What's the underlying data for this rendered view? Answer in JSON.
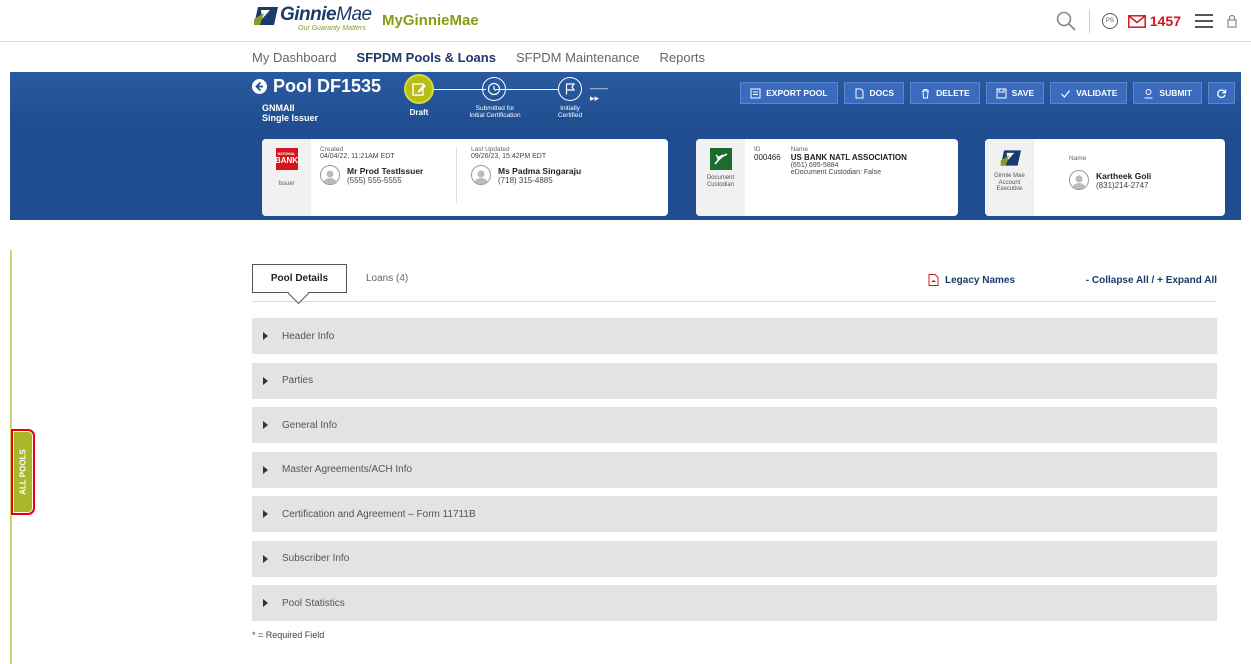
{
  "header": {
    "logo_name_bold": "Ginnie",
    "logo_name_light": "Mae",
    "logo_tagline": "Our Guaranty Matters",
    "app_name": "MyGinnieMae",
    "avatar_initials": "PS",
    "mail_count": "1457"
  },
  "nav": {
    "items": [
      {
        "label": "My Dashboard",
        "active": false
      },
      {
        "label": "SFPDM Pools & Loans",
        "active": true
      },
      {
        "label": "SFPDM Maintenance",
        "active": false
      },
      {
        "label": "Reports",
        "active": false
      }
    ]
  },
  "pool": {
    "title": "Pool DF1535",
    "type": "GNMAII",
    "issuer_type": "Single Issuer"
  },
  "stepper": {
    "steps": [
      {
        "label": "Draft",
        "active": true
      },
      {
        "label_line1": "Submitted for",
        "label_line2": "Initial Certification",
        "active": false
      },
      {
        "label_line1": "Initially",
        "label_line2": "Certified",
        "active": false
      }
    ]
  },
  "actions": {
    "export_pool": "EXPORT POOL",
    "docs": "DOCS",
    "delete": "DELETE",
    "save": "SAVE",
    "validate": "VALIDATE",
    "submit": "SUBMIT"
  },
  "issuer_card": {
    "logo_line1": "NATIONAL",
    "logo_line2": "BANK",
    "side_label": "Issuer",
    "created_label": "Created",
    "created_value": "04/04/22, 11:21AM EDT",
    "created_name": "Mr Prod TestIssuer",
    "created_phone": "(555) 555-5555",
    "updated_label": "Last Updated",
    "updated_value": "09/26/23, 15:42PM EDT",
    "updated_name": "Ms Padma Singaraju",
    "updated_phone": "(718) 315-4885"
  },
  "custodian_card": {
    "side_label_line1": "Document",
    "side_label_line2": "Custodian",
    "id_label": "ID",
    "name_label": "Name",
    "id_value": "000466",
    "name_value": "US BANK NATL ASSOCIATION",
    "phone": "(651) 695-5884",
    "edoc": "eDocument Custodian: False"
  },
  "exec_card": {
    "side_label_line1": "Ginnie Mae",
    "side_label_line2": "Account",
    "side_label_line3": "Executive",
    "name_label": "Name",
    "name_value": "Kartheek Goli",
    "phone": "(831)214-2747"
  },
  "sidebar": {
    "all_pools": "ALL POOLS"
  },
  "tabs": {
    "pool_details": "Pool Details",
    "loans": "Loans (4)",
    "legacy_names": "Legacy Names",
    "collapse_expand": "- Collapse All / + Expand All"
  },
  "sections": [
    "Header Info",
    "Parties",
    "General Info",
    "Master Agreements/ACH Info",
    "Certification and Agreement – Form 11711B",
    "Subscriber Info",
    "Pool Statistics"
  ],
  "footer": {
    "required_note": "* = Required Field"
  },
  "colors": {
    "brand_blue": "#1f4d8f",
    "brand_green": "#8a9a12",
    "alert_red": "#d4151b"
  }
}
